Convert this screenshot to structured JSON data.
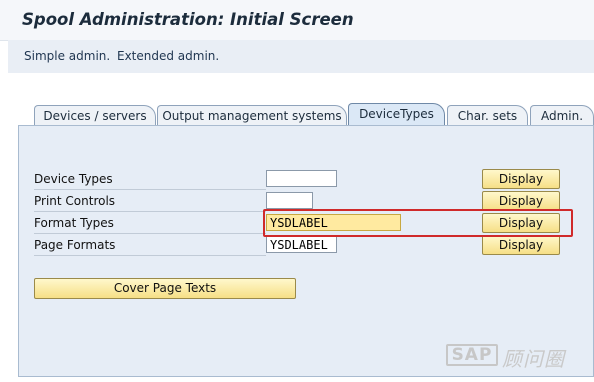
{
  "title": "Spool Administration: Initial Screen",
  "toolbar": {
    "simple_admin": "Simple admin.",
    "extended_admin": "Extended admin."
  },
  "tabs": [
    {
      "label": "Devices / servers",
      "active": false
    },
    {
      "label": "Output management systems",
      "active": false
    },
    {
      "label": "DeviceTypes",
      "active": true
    },
    {
      "label": "Char. sets",
      "active": false
    },
    {
      "label": "Admin.",
      "active": false
    }
  ],
  "rows": [
    {
      "label": "Device Types",
      "value": "",
      "button": "Display"
    },
    {
      "label": "Print Controls",
      "value": "",
      "button": "Display"
    },
    {
      "label": "Format Types",
      "value": "YSDLABEL",
      "button": "Display"
    },
    {
      "label": "Page Formats",
      "value": "YSDLABEL",
      "button": "Display"
    }
  ],
  "cover_page_button": "Cover Page Texts",
  "watermark": {
    "brand": "SAP",
    "text": "顾问圈"
  },
  "colors": {
    "highlight_box": "#d02a2a",
    "button_fill": "#f6df86",
    "input_highlight": "#ffeaa0",
    "panel_bg": "#e6edf6"
  }
}
